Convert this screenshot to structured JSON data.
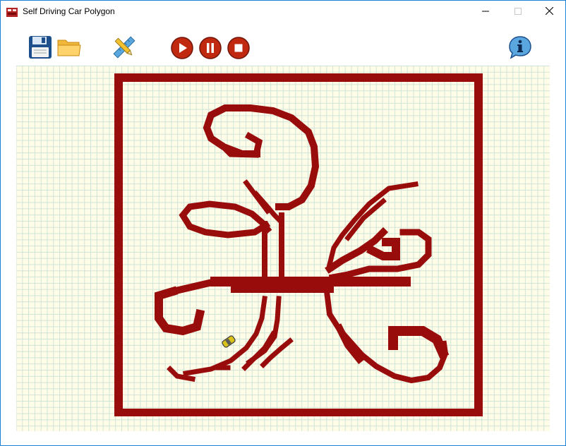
{
  "window": {
    "title": "Self Driving Car Polygon",
    "controls": [
      "minimize",
      "maximize",
      "close"
    ]
  },
  "toolbar": {
    "buttons": [
      {
        "name": "save",
        "icon": "floppy-disk-icon"
      },
      {
        "name": "open",
        "icon": "folder-icon"
      },
      {
        "name": "edit",
        "icon": "pencil-ruler-icon"
      },
      {
        "name": "play",
        "icon": "play-icon"
      },
      {
        "name": "pause",
        "icon": "pause-icon"
      },
      {
        "name": "stop",
        "icon": "stop-icon"
      },
      {
        "name": "info",
        "icon": "info-icon"
      }
    ]
  },
  "canvas": {
    "grid": true,
    "background_color": "#fffde8",
    "grid_color": "#cfe3d8",
    "track_color": "#990c0c",
    "car_color": "#d9c21a"
  }
}
